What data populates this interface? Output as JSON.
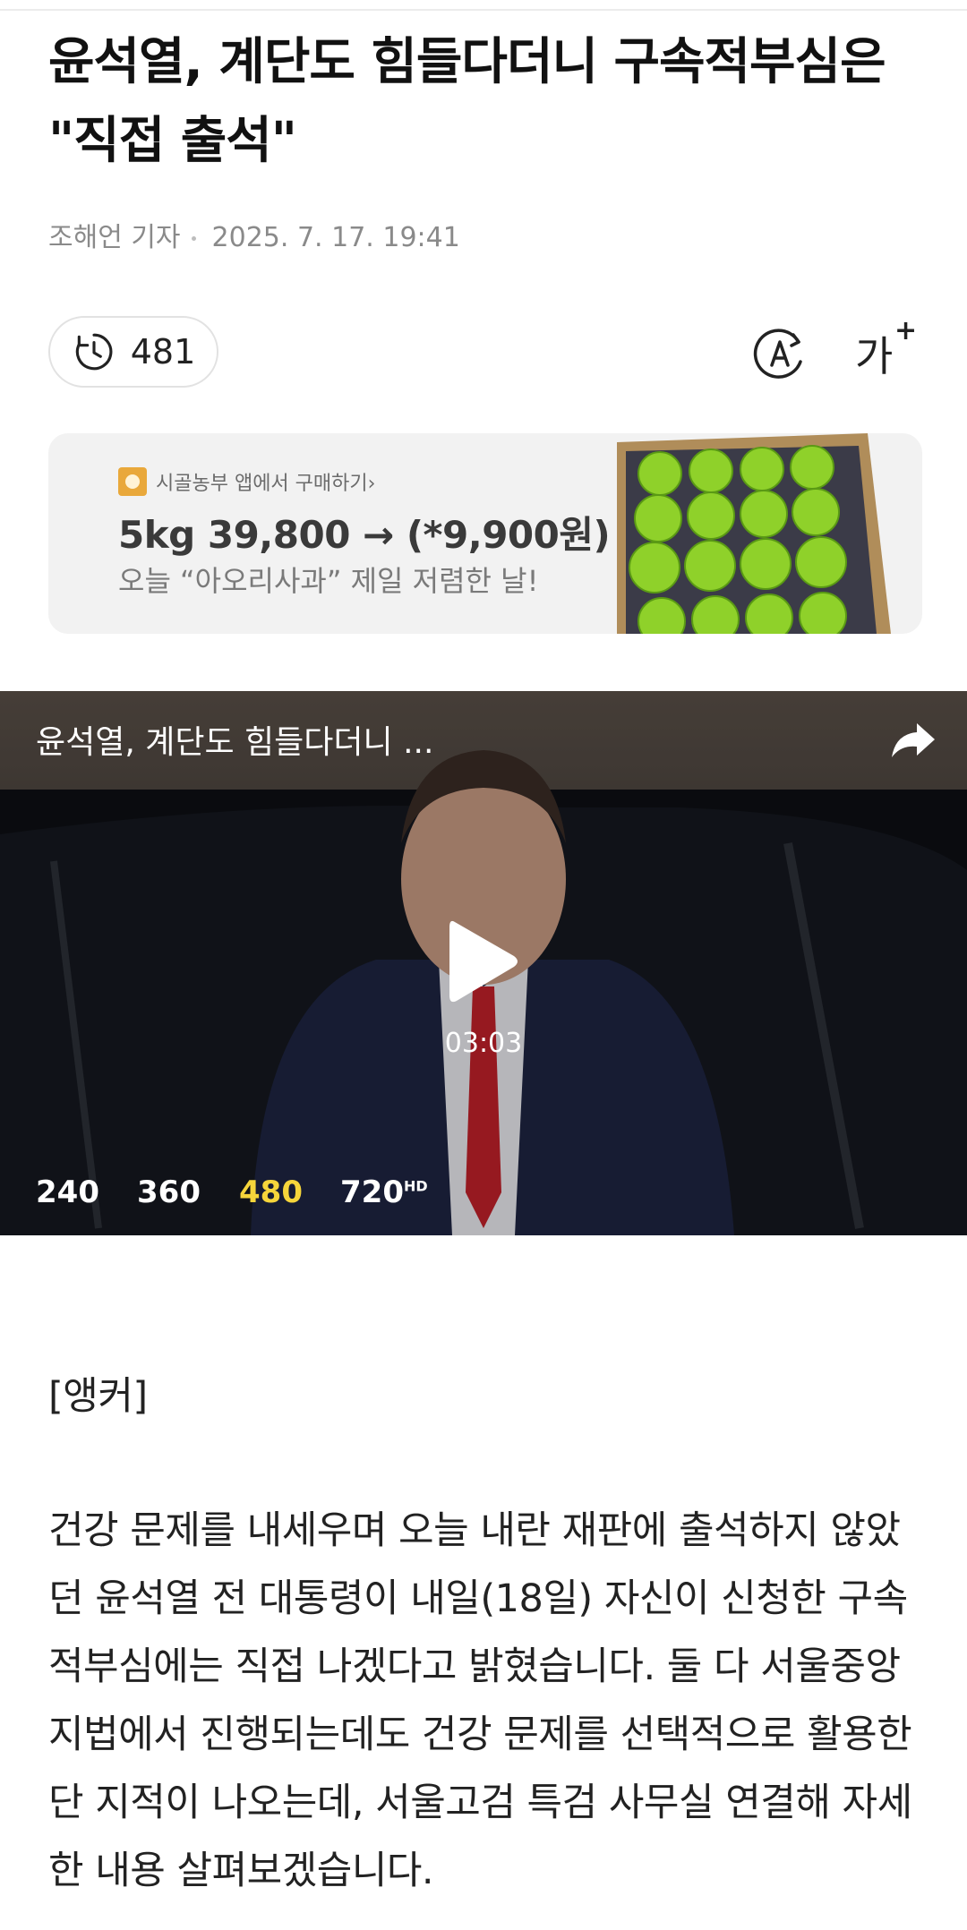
{
  "article": {
    "title": "윤석열, 계단도 힘들다더니 구속적부심은 \"직접 출석\"",
    "author": "조해언 기자",
    "datetime": "2025. 7. 17. 19:41",
    "history_count": "481",
    "font_size_label": "가",
    "font_size_plus": "+"
  },
  "ad": {
    "brand": "시골농부 앱에서 구매하기›",
    "price": "5kg 39,800 → (*9,900원)",
    "subtitle": "오늘 “아오리사과” 제일 저렴한 날!"
  },
  "video": {
    "title": "윤석열, 계단도 힘들다더니 ...",
    "duration": "03:03",
    "qualities": [
      "240",
      "360",
      "480",
      "720"
    ],
    "hd_badge": "HD",
    "selected_quality": "480"
  },
  "body": {
    "anchor": "[앵커]",
    "paragraph": "건강 문제를 내세우며 오늘 내란 재판에 출석하지 않았던 윤석열 전 대통령이 내일(18일) 자신이 신청한 구속적부심에는 직접 나겠다고 밝혔습니다. 둘 다 서울중앙지법에서 진행되는데도 건강 문제를 선택적으로 활용한단 지적이 나오는데, 서울고검 특검 사무실 연결해 자세한 내용 살펴보겠습니다."
  },
  "colors": {
    "selected_quality": "#f6d53b",
    "ad_background": "#f2f2f2",
    "muted_text": "#8a8a8a"
  }
}
